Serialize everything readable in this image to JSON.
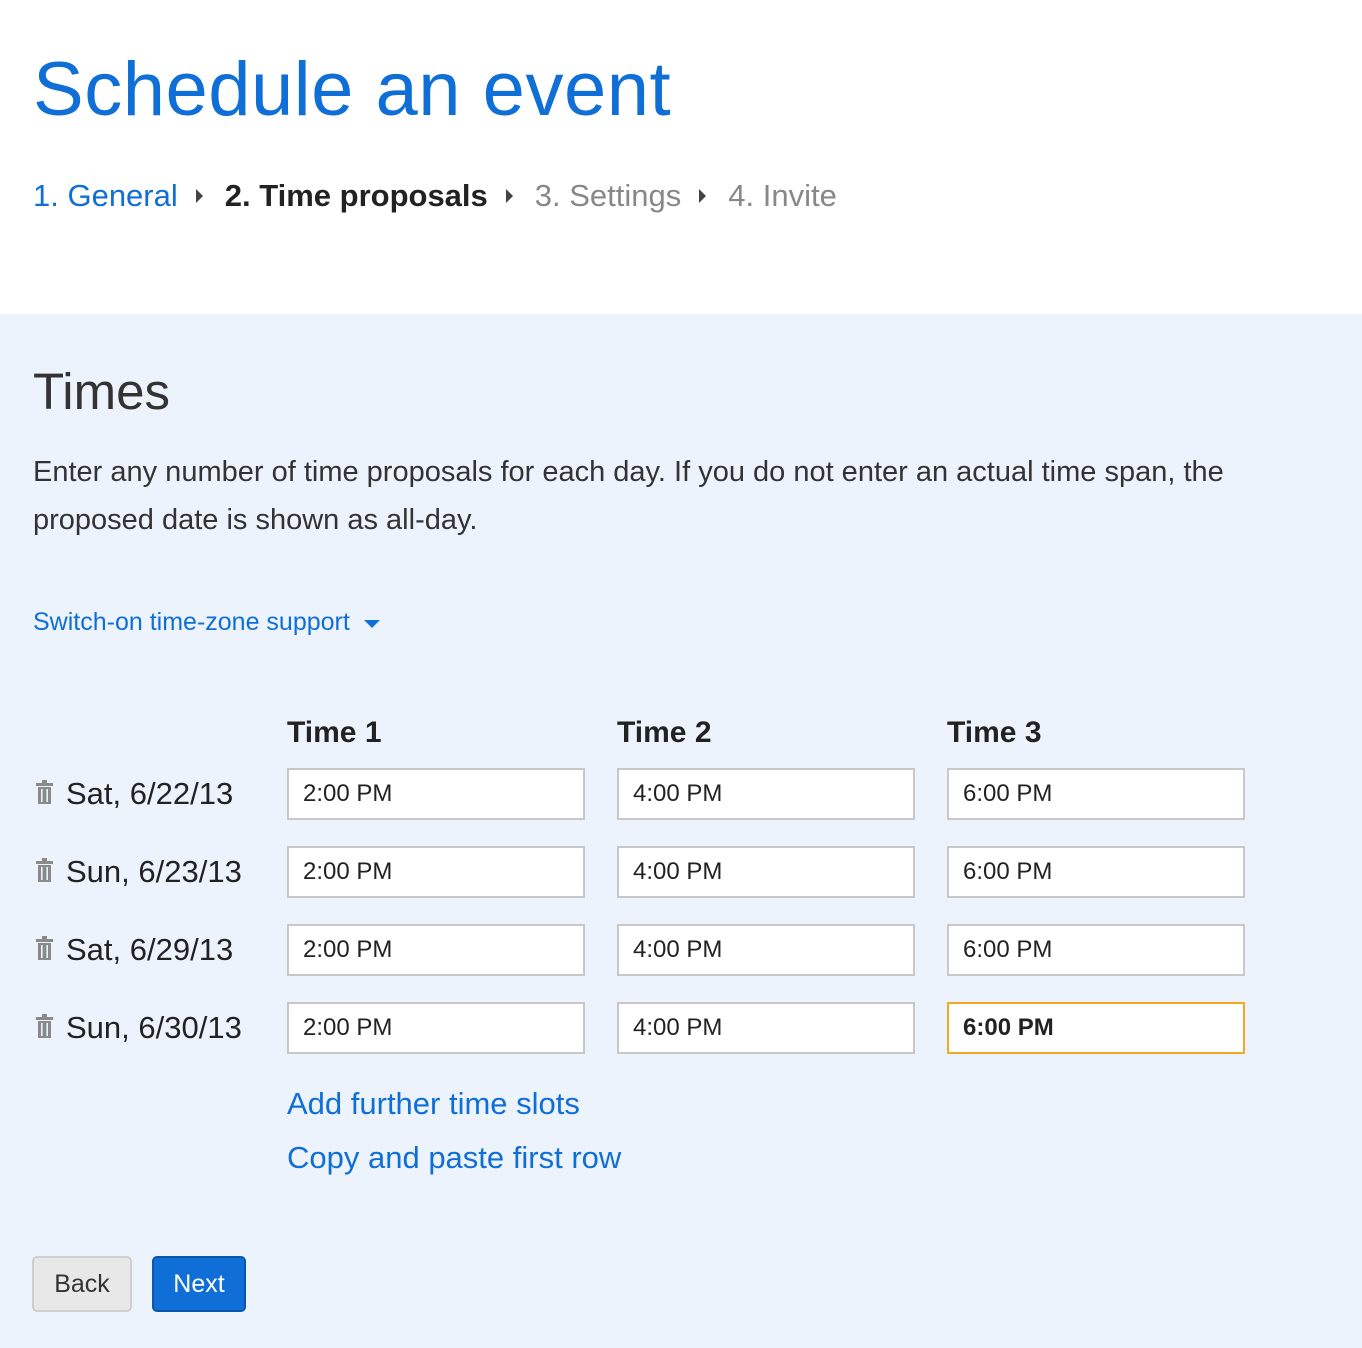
{
  "header": {
    "title": "Schedule an event",
    "steps": [
      {
        "label": "1. General",
        "state": "done"
      },
      {
        "label": "2. Time proposals",
        "state": "current"
      },
      {
        "label": "3. Settings",
        "state": "future"
      },
      {
        "label": "4. Invite",
        "state": "future"
      }
    ]
  },
  "times": {
    "title": "Times",
    "description": "Enter any number of time proposals for each day. If you do not enter an actual time span, the proposed date is shown as all-day.",
    "timezone_link": "Switch-on time-zone support",
    "columns": [
      "Time 1",
      "Time 2",
      "Time 3"
    ],
    "rows": [
      {
        "date": "Sat, 6/22/13",
        "times": [
          "2:00 PM",
          "4:00 PM",
          "6:00 PM"
        ]
      },
      {
        "date": "Sun, 6/23/13",
        "times": [
          "2:00 PM",
          "4:00 PM",
          "6:00 PM"
        ]
      },
      {
        "date": "Sat, 6/29/13",
        "times": [
          "2:00 PM",
          "4:00 PM",
          "6:00 PM"
        ]
      },
      {
        "date": "Sun, 6/30/13",
        "times": [
          "2:00 PM",
          "4:00 PM",
          "6:00 PM"
        ]
      }
    ],
    "add_slots_link": "Add further time slots",
    "copy_row_link": "Copy and paste first row"
  },
  "buttons": {
    "back": "Back",
    "next": "Next"
  },
  "colors": {
    "accent": "#0f6fd6",
    "panel_background": "#edf3fc",
    "focus_border": "#f5a623"
  }
}
